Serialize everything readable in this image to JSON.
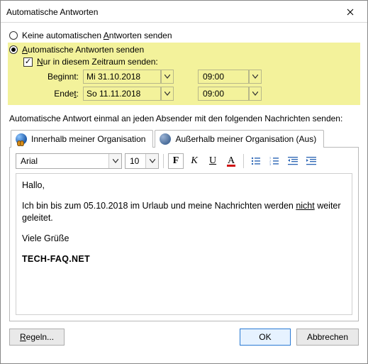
{
  "title": "Automatische Antworten",
  "radios": {
    "off_prefix": "Keine automatischen ",
    "off_key": "A",
    "off_suffix": "ntworten senden",
    "on_prefix": "",
    "on_key": "A",
    "on_suffix": "utomatische Antworten senden"
  },
  "timerange": {
    "check_prefix": "",
    "check_key": "N",
    "check_suffix": "ur in diesem Zeitraum senden:",
    "begin_prefix": "Be",
    "begin_key": "g",
    "begin_suffix": "innt:",
    "begin_date": "Mi 31.10.2018",
    "begin_time": "09:00",
    "end_prefix": "Ende",
    "end_key": "t",
    "end_suffix": ":",
    "end_date": "So 11.11.2018",
    "end_time": "09:00"
  },
  "instruction": "Automatische Antwort einmal an jeden Absender mit den folgenden Nachrichten senden:",
  "tabs": {
    "inside": "Innerhalb meiner Organisation",
    "outside": "Außerhalb meiner Organisation (Aus)"
  },
  "toolbar": {
    "font": "Arial",
    "size": "10",
    "bold": "F",
    "italic": "K",
    "underline": "U",
    "fontcolor": "A"
  },
  "message": {
    "greet": "Hallo,",
    "body_pre": "Ich bin bis zum 05.10.2018 im Urlaub und meine Nachrichten werden ",
    "body_u": "nicht",
    "body_post": " weiter geleitet.",
    "closing": "Viele Grüße",
    "signature": "TECH-FAQ.NET"
  },
  "footer": {
    "rules_prefix": "",
    "rules_key": "R",
    "rules_suffix": "egeln",
    "ok": "OK",
    "cancel": "Abbrechen"
  }
}
